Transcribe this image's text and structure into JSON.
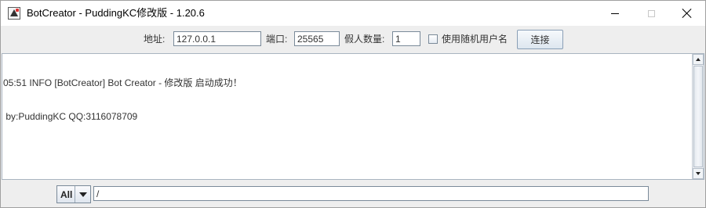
{
  "window": {
    "title": "BotCreator - PuddingKC修改版 - 1.20.6",
    "app_icon": "app-icon",
    "controls": {
      "minimize": "minimize-icon",
      "maximize": "maximize-icon",
      "close": "close-icon"
    }
  },
  "connection": {
    "address_label": "地址:",
    "address_value": "127.0.0.1",
    "port_label": "端口:",
    "port_value": "25565",
    "bot_count_label": "假人数量:",
    "bot_count_value": "1",
    "random_username_label": "使用随机用户名",
    "random_username_checked": false,
    "connect_label": "连接"
  },
  "log": {
    "lines": [
      "05:51 INFO [BotCreator] Bot Creator - 修改版 启动成功！",
      " by:PuddingKC QQ:3116078709"
    ]
  },
  "command": {
    "target_value": "All",
    "input_value": "/"
  }
}
